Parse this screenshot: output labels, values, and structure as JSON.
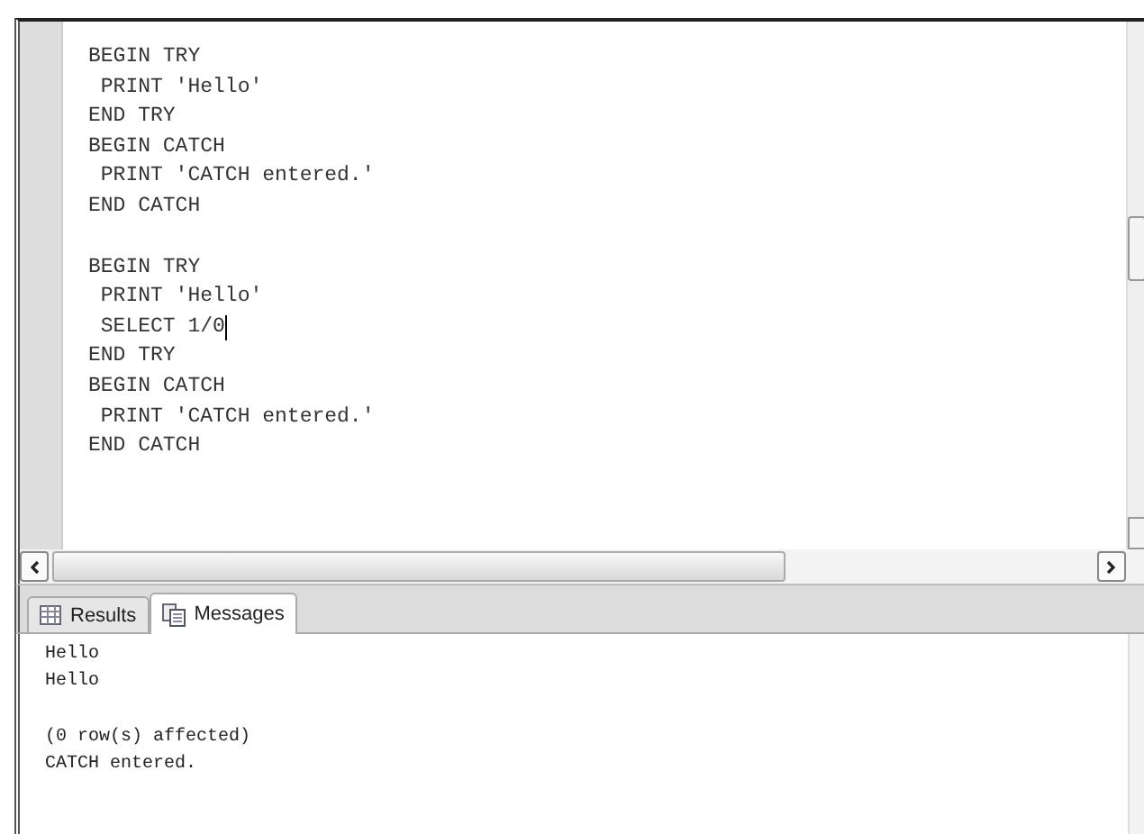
{
  "editor": {
    "blocks": [
      {
        "lines": [
          {
            "text": "BEGIN TRY",
            "cursor": false
          },
          {
            "text": " PRINT 'Hello'",
            "cursor": false
          },
          {
            "text": "END TRY",
            "cursor": false
          },
          {
            "text": "BEGIN CATCH",
            "cursor": false
          },
          {
            "text": " PRINT 'CATCH entered.'",
            "cursor": false
          },
          {
            "text": "END CATCH",
            "cursor": false
          }
        ]
      },
      {
        "lines": [
          {
            "text": "BEGIN TRY",
            "cursor": false
          },
          {
            "text": " PRINT 'Hello'",
            "cursor": false
          },
          {
            "text": " SELECT 1/0",
            "cursor": true
          },
          {
            "text": "END TRY",
            "cursor": false
          },
          {
            "text": "BEGIN CATCH",
            "cursor": false
          },
          {
            "text": " PRINT 'CATCH entered.'",
            "cursor": false
          },
          {
            "text": "END CATCH",
            "cursor": false
          }
        ]
      }
    ]
  },
  "tabs": [
    {
      "label": "Results",
      "kind": "grid",
      "selected": false
    },
    {
      "label": "Messages",
      "kind": "messages",
      "selected": true
    }
  ],
  "messages": {
    "groups": [
      {
        "lines": [
          "Hello",
          "Hello"
        ]
      },
      {
        "lines": [
          "(0 row(s) affected)",
          "CATCH entered."
        ]
      }
    ]
  }
}
